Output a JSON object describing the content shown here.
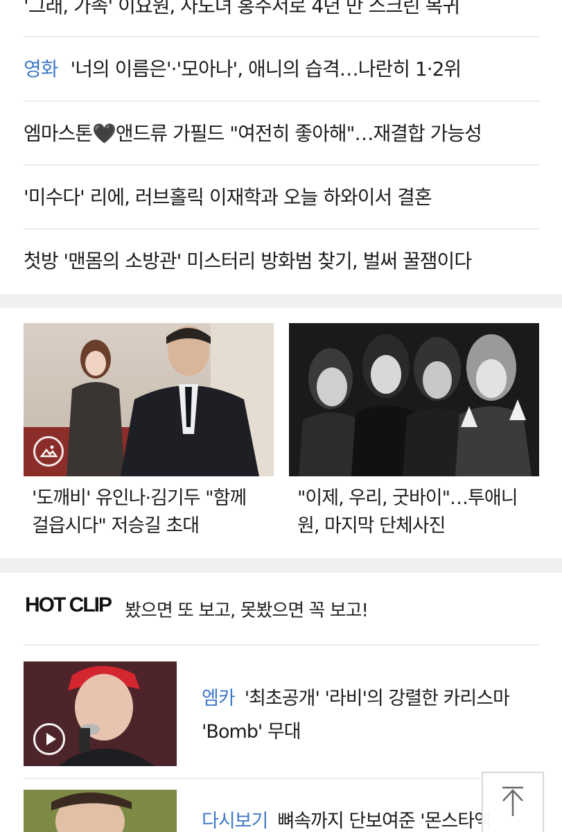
{
  "headlines": [
    {
      "category": "",
      "text": "'그래, 가족' 이요원, 사도녀 홍주서로 4년 만 스크린 복귀"
    },
    {
      "category": "영화",
      "text": "'너의 이름은'·'모아나', 애니의 습격…나란히 1·2위"
    },
    {
      "category": "",
      "text": "엠마스톤🖤앤드류 가필드 \"여전히 좋아해\"…재결합 가능성"
    },
    {
      "category": "",
      "text": "'미수다' 리에, 러브홀릭 이재학과 오늘 하와이서 결혼"
    },
    {
      "category": "",
      "text": "첫방 '맨몸의 소방관' 미스터리 방화범 찾기, 벌써 꿀잼이다"
    }
  ],
  "photo_cards": [
    {
      "caption": "'도깨비' 유인나·김기두 \"함께 걸읍시다\" 저승길 초대",
      "icon": "gallery-icon"
    },
    {
      "caption": "\"이제, 우리, 굿바이\"…투애니원, 마지막 단체사진",
      "icon": ""
    }
  ],
  "hot_clip": {
    "title": "HOT CLIP",
    "subtitle": "봤으면 또 보고, 못봤으면 꼭 보고!",
    "items": [
      {
        "category": "엠카",
        "text": "'최초공개' '라비'의 강렬한 카리스마 'Bomb' 무대",
        "icon": "play-icon"
      },
      {
        "category": "다시보기",
        "text": "뼈속까지 단보여준 '몬스타엑",
        "icon": ""
      }
    ]
  },
  "scroll_top": {
    "icon": "arrow-up-icon"
  },
  "colors": {
    "accent": "#3f79c8",
    "text": "#1c1c1c",
    "divider": "#ececec",
    "section_gap": "#f0f0f0"
  }
}
